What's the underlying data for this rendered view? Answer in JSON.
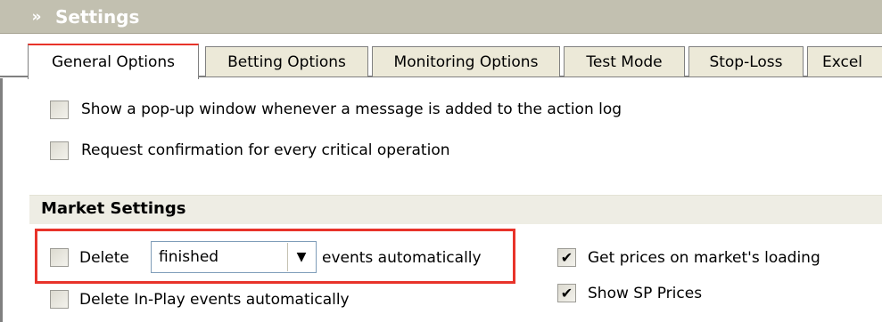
{
  "panel": {
    "title": "Settings",
    "collapse_glyph": "»"
  },
  "tabs": [
    {
      "label": "General Options",
      "active": true
    },
    {
      "label": "Betting Options",
      "active": false
    },
    {
      "label": "Monitoring Options",
      "active": false
    },
    {
      "label": "Test Mode",
      "active": false
    },
    {
      "label": "Stop-Loss",
      "active": false
    },
    {
      "label": "Excel",
      "active": false
    }
  ],
  "general": {
    "popup_label": "Show a pop-up window whenever a message is added to the action log",
    "popup_checked": false,
    "confirm_label": "Request confirmation for every critical operation",
    "confirm_checked": false
  },
  "market": {
    "section_title": "Market Settings",
    "delete_label": "Delete",
    "delete_checked": false,
    "delete_select_value": "finished",
    "delete_suffix": "events automatically",
    "inplay_label": "Delete In-Play events automatically",
    "inplay_checked": false,
    "prices_label": "Get prices on market's loading",
    "prices_checked": true,
    "sp_label": "Show SP Prices",
    "sp_checked": true,
    "check_glyph": "✔",
    "arrow_glyph": "▼"
  },
  "colors": {
    "accent_red": "#e8332a",
    "title_bar": "#c2c0b0",
    "tab_bg": "#ece9d8",
    "section_bg": "#eeede4"
  }
}
